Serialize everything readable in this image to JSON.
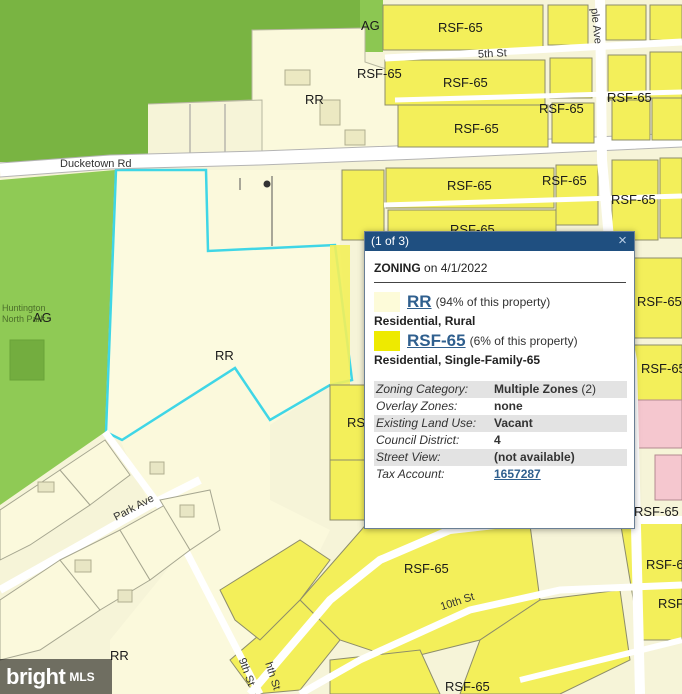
{
  "map": {
    "zone_labels": {
      "ag_top": "AG",
      "ag_left": "AG",
      "rr_top": "RR",
      "rr_parcel": "RR",
      "rr_bottom": "RR",
      "rsf65_1": "RSF-65",
      "rsf65_2": "RSF-65",
      "rsf65_3": "RSF-65",
      "rsf65_4": "RSF-65",
      "rsf65_5": "RSF-65",
      "rsf65_6": "RSF-65",
      "rsf65_7": "RSF-65",
      "rsf65_8": "RSF-65",
      "rsf65_9": "RSF-65",
      "rsf65_10": "RSF-65",
      "rsf65_11": "RSF-65",
      "rsf65_12": "RSF-65",
      "rsf65_13": "RSF-65",
      "rsf65_14": "RSF-65",
      "rsf65_15": "RSF-65",
      "rsf65_16": "RSF-65",
      "rsf65_17": "RSF-65",
      "rsf65_18": "RSF-65",
      "rs_partial": "RS"
    },
    "streets": {
      "ducketown": "Ducketown Rd",
      "fifth": "5th St",
      "park_ave": "Park Ave",
      "ple_ave": "ple Ave",
      "tenth": "10th St",
      "ninth": "9th St",
      "hth": "hth St"
    },
    "park_name": "Huntington North Park",
    "colors": {
      "park_green": "#78b441",
      "park_light": "#a8d56a",
      "rr_fill": "#fdfbd9",
      "rsf_fill": "#f3ef5a",
      "selection": "#3fd6e6",
      "parcel_line": "#9a9a9a",
      "commercial_pink": "#f5c7cf"
    }
  },
  "popup": {
    "header": "(1 of 3)",
    "close_symbol": "×",
    "zoning_label": "ZONING",
    "zoning_date": "on 4/1/2022",
    "zones": [
      {
        "code": "RR",
        "pct": "(94% of this property)",
        "desc": "Residential, Rural",
        "color": "#fdfbd9"
      },
      {
        "code": "RSF-65",
        "pct": "(6% of this property)",
        "desc": "Residential, Single-Family-65",
        "color": "#eeea00"
      }
    ],
    "attributes": [
      {
        "key": "Zoning Category:",
        "value": "Multiple Zones",
        "extra": "(2)"
      },
      {
        "key": "Overlay Zones:",
        "value": "none"
      },
      {
        "key": "Existing Land Use:",
        "value": "Vacant"
      },
      {
        "key": "Council District:",
        "value": "4"
      },
      {
        "key": "Street View:",
        "value": "(not available)"
      },
      {
        "key": "Tax Account:",
        "value": "1657287",
        "link": true
      }
    ]
  },
  "watermark": {
    "brand": "bright",
    "suffix": "MLS"
  }
}
